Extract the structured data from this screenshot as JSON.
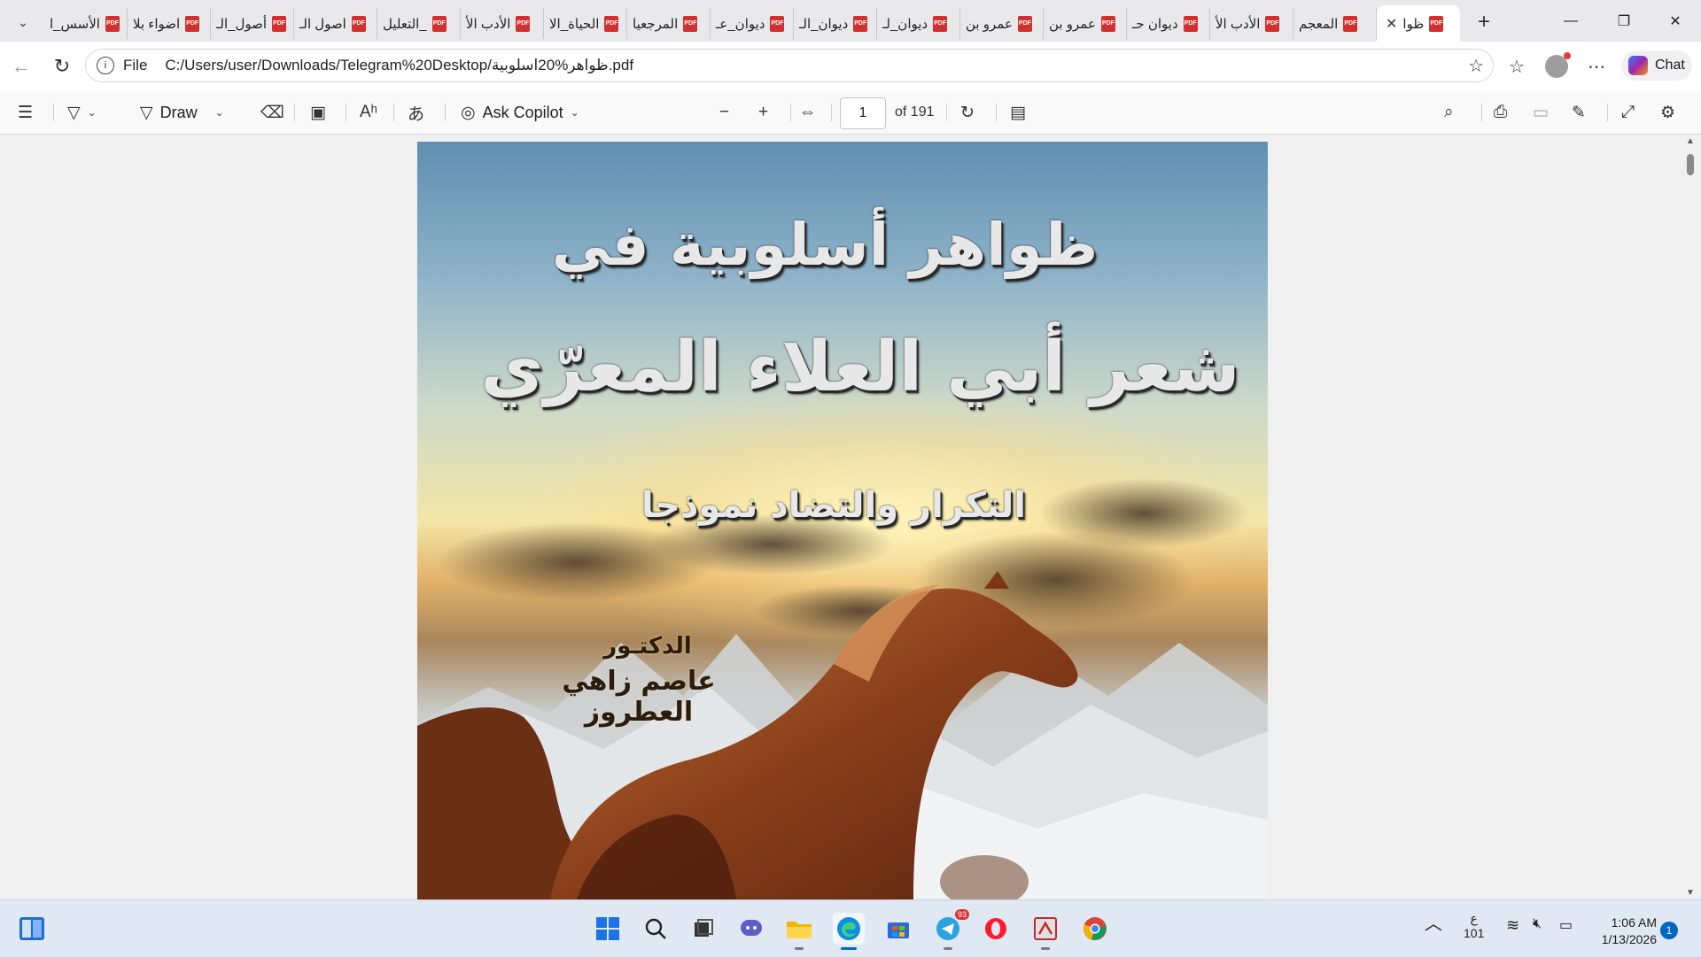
{
  "tabs": [
    {
      "title": "ظوا",
      "active": true
    },
    {
      "title": "المعجم"
    },
    {
      "title": "الأدب الأ"
    },
    {
      "title": "ديوان حـ"
    },
    {
      "title": "عمرو بن"
    },
    {
      "title": "عمرو بن"
    },
    {
      "title": "ديوان_لـ"
    },
    {
      "title": "ديوان_الـ"
    },
    {
      "title": "ديوان_عـ"
    },
    {
      "title": "المرجعيا"
    },
    {
      "title": "الحياة_الا"
    },
    {
      "title": "الأدب الأ"
    },
    {
      "title": "التعليل_"
    },
    {
      "title": "اصول الـ"
    },
    {
      "title": "أصول_الـ"
    },
    {
      "title": "اضواء بلا"
    },
    {
      "title": "الأسس_ا"
    }
  ],
  "address": {
    "scheme_label": "File",
    "url": "C:/Users/user/Downloads/Telegram%20Desktop/ظواهر%20اسلوبية.pdf"
  },
  "browser": {
    "chat_label": "Chat"
  },
  "pdf_toolbar": {
    "draw_label": "Draw",
    "copilot_label": "Ask Copilot",
    "page_number": "1",
    "page_count": "of 191"
  },
  "cover": {
    "title_line1": "ظواهر أسلوبية في",
    "title_line2": "شعر أبي العلاء المعرّي",
    "subtitle": "التكرار والتضاد نموذجا",
    "doctor": "الدكتـور",
    "author": "عاصم زاهي العطروز"
  },
  "taskbar": {
    "telegram_badge": "93",
    "ime_top": "ع",
    "ime_bottom": "101",
    "time": "1:06 AM",
    "date": "1/13/2026",
    "notifications": "1"
  },
  "colors": {
    "tabstrip": "#e9e9ec",
    "pdf_icon": "#d32f2f",
    "accent": "#0067c0",
    "taskbar": "#dfe8f3"
  }
}
